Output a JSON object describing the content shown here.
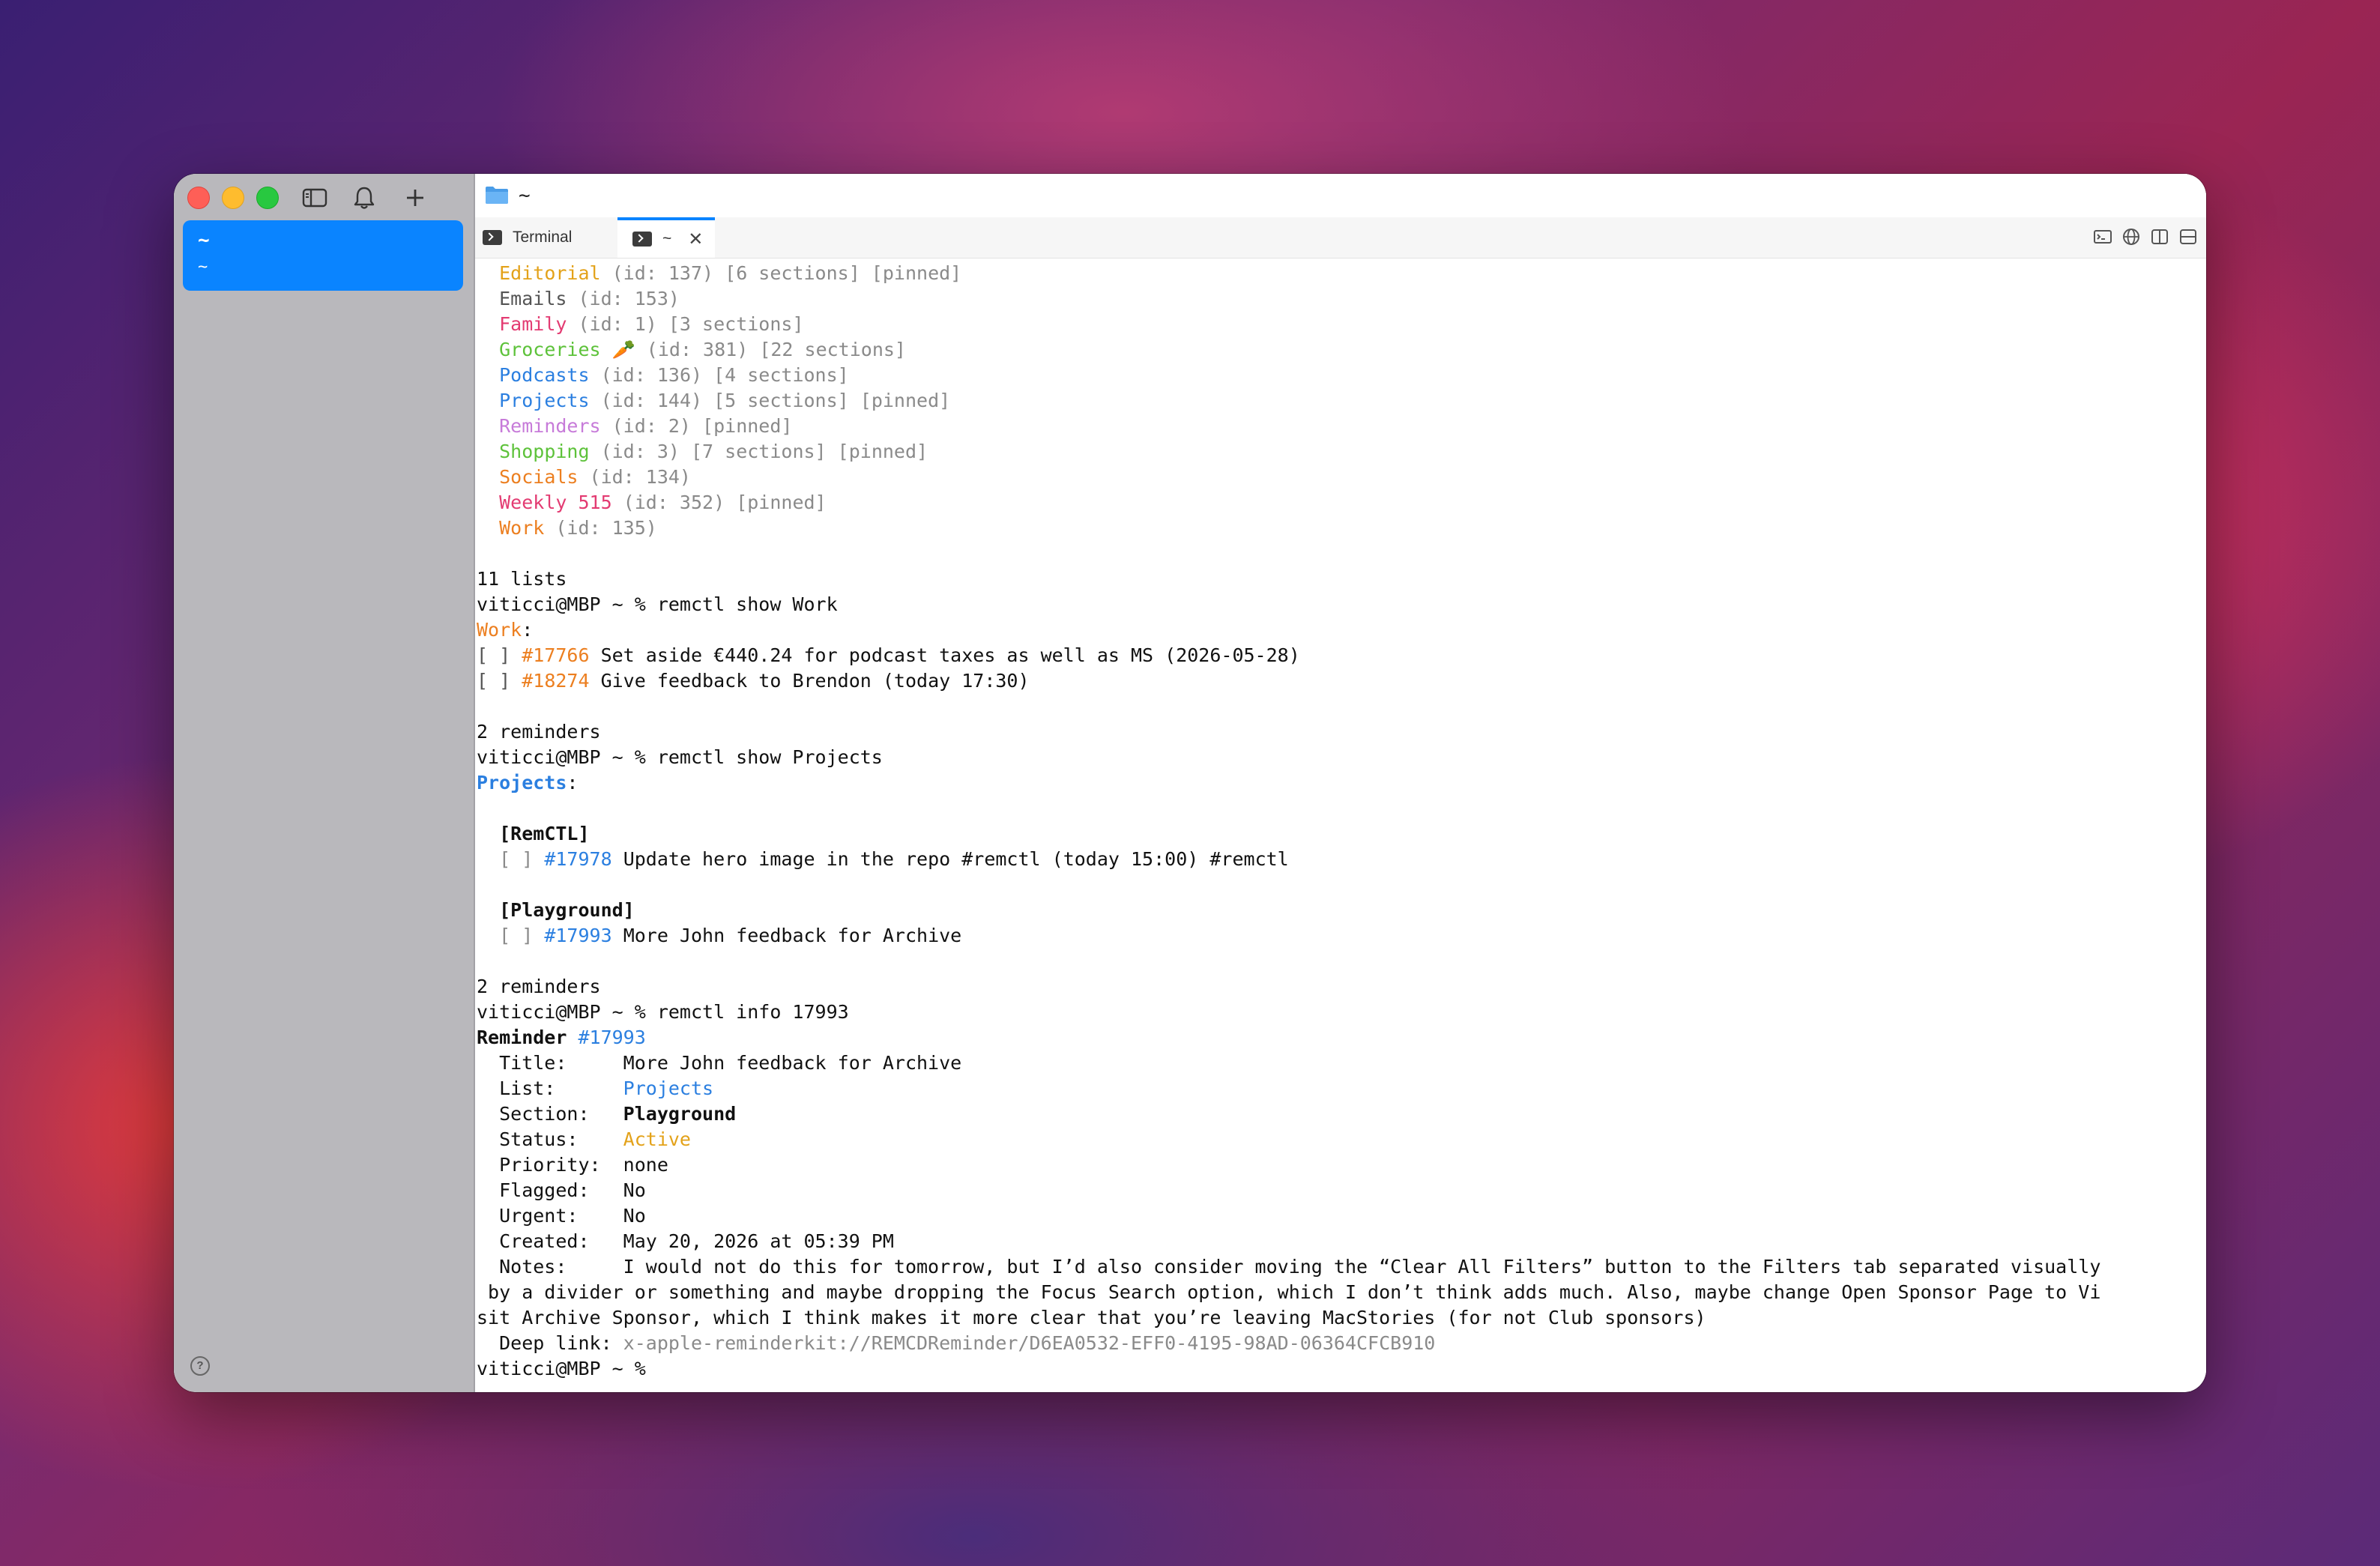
{
  "sidebar": {
    "tab_line1": "~",
    "tab_line2": "~",
    "help": "?"
  },
  "titlebar": {
    "path": "~"
  },
  "tabs": [
    {
      "label": "Terminal"
    },
    {
      "label": "~",
      "close": "✕"
    }
  ],
  "terminal": {
    "lists": [
      {
        "name": "Editorial",
        "meta": " (id: 137) [6 sections] [pinned]"
      },
      {
        "name": "Emails",
        "meta": " (id: 153)"
      },
      {
        "name": "Family",
        "meta": " (id: 1) [3 sections]"
      },
      {
        "name": "Groceries 🥕",
        "meta": " (id: 381) [22 sections]"
      },
      {
        "name": "Podcasts",
        "meta": " (id: 136) [4 sections]"
      },
      {
        "name": "Projects",
        "meta": " (id: 144) [5 sections] [pinned]"
      },
      {
        "name": "Reminders",
        "meta": " (id: 2) [pinned]"
      },
      {
        "name": "Shopping",
        "meta": " (id: 3) [7 sections] [pinned]"
      },
      {
        "name": "Socials",
        "meta": " (id: 134)"
      },
      {
        "name": "Weekly 515",
        "meta": " (id: 352) [pinned]"
      },
      {
        "name": "Work",
        "meta": " (id: 135)"
      }
    ],
    "lists_count": "11 lists",
    "cmd_show_work": "viticci@MBP ~ % remctl show Work",
    "work_header": "Work",
    "work_items": [
      {
        "box": "[ ] ",
        "id": "#17766",
        "text": " Set aside €440.24 for podcast taxes as well as MS (2026-05-28)"
      },
      {
        "box": "[ ] ",
        "id": "#18274",
        "text": " Give feedback to Brendon (today 17:30)"
      }
    ],
    "work_count": "2 reminders",
    "cmd_show_projects": "viticci@MBP ~ % remctl show Projects",
    "projects_header": "Projects",
    "section1": "[RemCTL]",
    "section1_item": {
      "box": "[ ] ",
      "id": "#17978",
      "text": " Update hero image in the repo #remctl (today 15:00) #remctl"
    },
    "section2": "[Playground]",
    "section2_item": {
      "box": "[ ] ",
      "id": "#17993",
      "text": " More John feedback for Archive"
    },
    "projects_count": "2 reminders",
    "cmd_info": "viticci@MBP ~ % remctl info 17993",
    "reminder_label": "Reminder ",
    "reminder_id": "#17993",
    "info": {
      "title_label": "  Title:     ",
      "title": "More John feedback for Archive",
      "list_label": "  List:      ",
      "list": "Projects",
      "section_label": "  Section:   ",
      "section": "Playground",
      "status_label": "  Status:    ",
      "status": "Active",
      "priority": "  Priority:  none",
      "flagged": "  Flagged:   No",
      "urgent": "  Urgent:    No",
      "created": "  Created:   May 20, 2026 at 05:39 PM",
      "notes1": "  Notes:     I would not do this for tomorrow, but I’d also consider moving the “Clear All Filters” button to the Filters tab separated visually",
      "notes2": " by a divider or something and maybe dropping the Focus Search option, which I don’t think adds much. Also, maybe change Open Sponsor Page to Vi",
      "notes3": "sit Archive Sponsor, which I think makes it more clear that you’re leaving MacStories (for not Club sponsors)",
      "deeplink_label": "  Deep link: ",
      "deeplink": "x-apple-reminderkit://REMCDReminder/D6EA0532-EFF0-4195-98AD-06364CFCB910"
    },
    "prompt": "viticci@MBP ~ % "
  }
}
